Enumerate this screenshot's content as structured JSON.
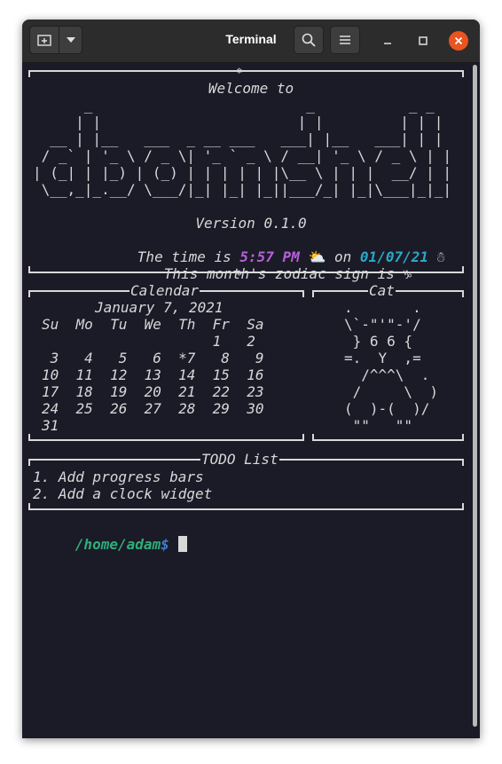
{
  "window": {
    "title": "Terminal",
    "accent_close": "#e95420",
    "bg": "#1b1a27"
  },
  "header": {
    "welcome": "Welcome to",
    "ascii_logo": "      _                         _           _ _\n     | |                       | |         | | |\n  __ | |__   ___  _ __ ___   ___| |__   ___| | |\n / _` | '_ \\ / _ \\| '_ ` _ \\ / __| '_ \\ / _ \\ | |\n| (_| | |_) | (_) | | | | | |\\__ \\ | | |  __/ | |\n \\__,_|_.__/ \\___/|_| |_| |_||___/_| |_|\\___|_|_|",
    "version": "Version 0.1.0",
    "time_prefix": "The time is ",
    "time_value": "5:57 PM",
    "time_mid": " on ",
    "date_value": "01/07/21",
    "zodiac": "This month's zodiac sign is"
  },
  "calendar": {
    "title": "Calendar",
    "month": "January 7, 2021",
    "days_header": "Su  Mo  Tu  We  Th  Fr  Sa",
    "weeks": [
      "                    1   2",
      " 3   4   5   6  *7   8   9",
      "10  11  12  13  14  15  16",
      "17  18  19  20  21  22  23",
      "24  25  26  27  28  29  30",
      "31"
    ]
  },
  "cat": {
    "title": "Cat",
    "art": ".       .\n\\`-\"'\"-'/\n } 6 6 {\n=.  Y  ,=\n  /^^^\\  .\n /     \\  )\n(  )-(  )/\n \"\"   \"\""
  },
  "todo": {
    "title": "TODO List",
    "items": [
      "1. Add progress bars",
      "2. Add a clock widget"
    ]
  },
  "prompt": {
    "path": "/home/adam",
    "symbol": "$"
  },
  "icons": {
    "new_tab": "new-tab-icon",
    "dropdown": "chevron-down-icon",
    "search": "search-icon",
    "menu": "hamburger-menu-icon",
    "minimize": "minimize-icon",
    "maximize": "maximize-icon",
    "close": "close-icon",
    "weather": "sun-behind-cloud-icon",
    "snowman": "snowman-icon",
    "zodiac": "goat-icon"
  }
}
